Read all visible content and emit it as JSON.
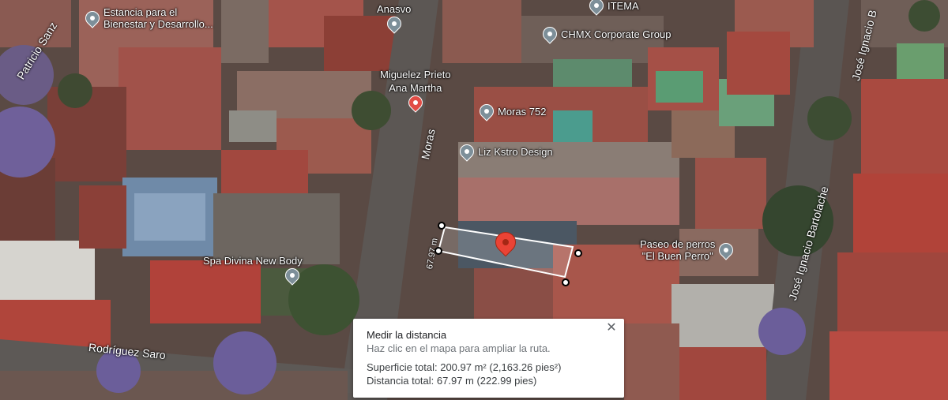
{
  "map": {
    "pois": [
      {
        "label_lines": [
          "Estancia para el",
          "Bienestar y Desarrollo..."
        ],
        "icon": "school-pin-icon",
        "color": "#7d8f99"
      },
      {
        "label_lines": [
          "Anasvo"
        ],
        "icon": "place-pin-icon",
        "color": "#7d8f99"
      },
      {
        "label_lines": [
          "ITEMA"
        ],
        "icon": "place-pin-icon",
        "color": "#7d8f99"
      },
      {
        "label_lines": [
          "CHMX Corporate Group"
        ],
        "icon": "place-pin-icon",
        "color": "#7d8f99"
      },
      {
        "label_lines": [
          "Miguelez Prieto",
          "Ana Martha"
        ],
        "icon": "business-pin-icon",
        "color": "#e14c45"
      },
      {
        "label_lines": [
          "Moras 752"
        ],
        "icon": "place-pin-icon",
        "color": "#7d8f99"
      },
      {
        "label_lines": [
          "Liz Kstro Design"
        ],
        "icon": "place-pin-icon",
        "color": "#7d8f99"
      },
      {
        "label_lines": [
          "Spa Divina New Body"
        ],
        "icon": "place-pin-icon",
        "color": "#7d8f99"
      },
      {
        "label_lines": [
          "Paseo de perros",
          "\"El Buen Perro\""
        ],
        "icon": "place-pin-icon",
        "color": "#7d8f99"
      }
    ],
    "streets": [
      "Patricio Sanz",
      "Moras",
      "Rodríguez Saro",
      "José Ignacio Bartolache",
      "José Ignacio B"
    ],
    "measure_segment_label": "67.97 m",
    "marker_color": "#ea4335"
  },
  "panel": {
    "title": "Medir la distancia",
    "hint": "Haz clic en el mapa para ampliar la ruta.",
    "area": "Superficie total: 200.97 m² (2,163.26 pies²)",
    "distance": "Distancia total: 67.97 m (222.99 pies)",
    "close_label": "✕"
  }
}
